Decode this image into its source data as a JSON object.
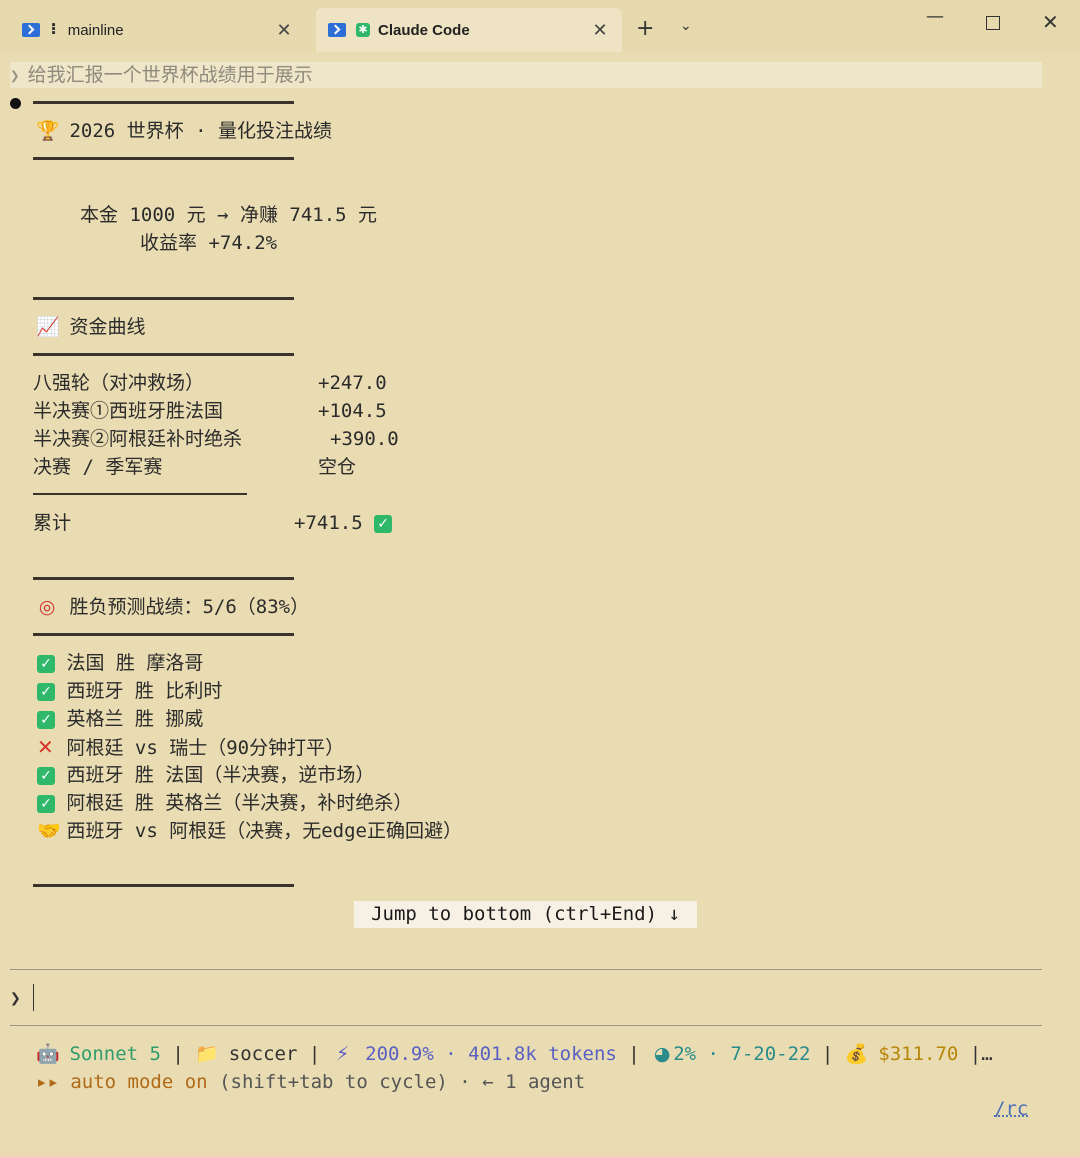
{
  "tabs": [
    {
      "label": "mainline",
      "active": false
    },
    {
      "label": "Claude Code",
      "active": true
    }
  ],
  "prompt_echo": "给我汇报一个世界杯战绩用于展示",
  "header": {
    "icon": "trophy-icon",
    "title": "2026 世界杯 · 量化投注战绩"
  },
  "summary": {
    "line1": "本金 1000 元 → 净赚 741.5 元",
    "line2": "收益率 +74.2%"
  },
  "curve": {
    "icon": "chart-increasing-icon",
    "title": "资金曲线",
    "rows": [
      {
        "label": "八强轮（对冲救场）",
        "value": "+247.0"
      },
      {
        "label": "半决赛①西班牙胜法国",
        "value": "+104.5"
      },
      {
        "label": "半决赛②阿根廷补时绝杀",
        "value": "+390.0"
      },
      {
        "label": "决赛 / 季军赛",
        "value": "空仓"
      }
    ],
    "total_label": "累计",
    "total_value": "+741.5"
  },
  "predictions": {
    "icon": "target-icon",
    "title": "胜负预测战绩：5/6（83%）",
    "items": [
      {
        "status": "correct",
        "text": "法国 胜 摩洛哥"
      },
      {
        "status": "correct",
        "text": "西班牙 胜 比利时"
      },
      {
        "status": "correct",
        "text": "英格兰 胜 挪威"
      },
      {
        "status": "wrong",
        "text": "阿根廷 vs 瑞士（90分钟打平）"
      },
      {
        "status": "correct",
        "text": "西班牙 胜 法国（半决赛，逆市场）"
      },
      {
        "status": "correct",
        "text": "阿根廷 胜 英格兰（半决赛，补时绝杀）"
      },
      {
        "status": "avoided",
        "text": "西班牙 vs 阿根廷（决赛，无edge正确回避）"
      }
    ]
  },
  "jump_button": "Jump to bottom (ctrl+End) ↓",
  "status_line": {
    "model": "Sonnet 5",
    "folder": "soccer",
    "percent": "200.9%",
    "tokens": "401.8k tokens",
    "context": "2%",
    "version": "7-20-22",
    "cost": "$311.70",
    "more": "|…"
  },
  "mode_line": {
    "mode": "auto mode on",
    "hint": "(shift+tab to cycle)",
    "agents": "← 1 agent"
  },
  "rc_link": "/rc"
}
